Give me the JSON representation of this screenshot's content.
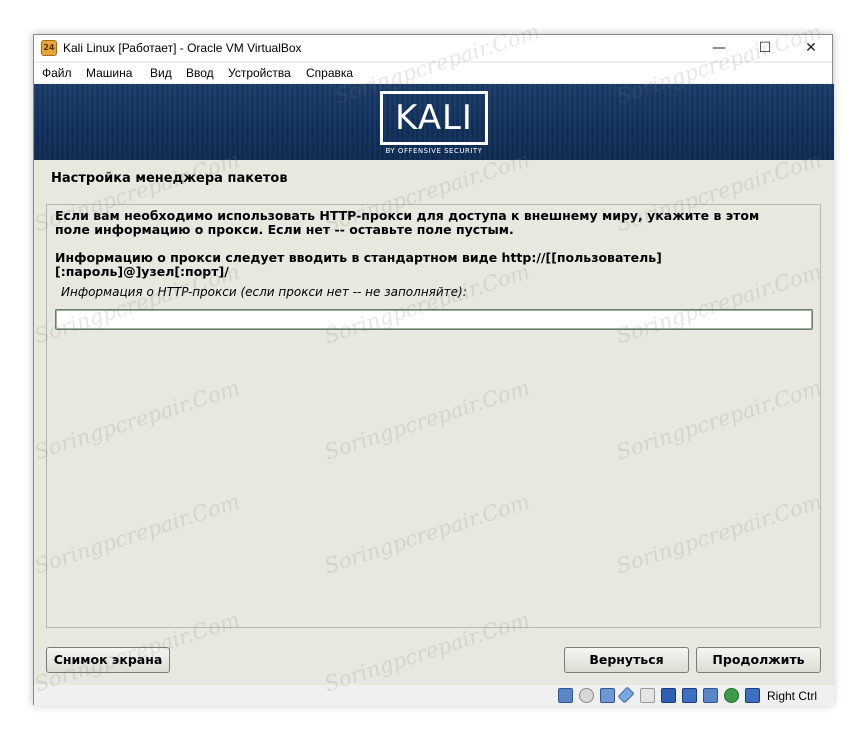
{
  "window": {
    "title": "Kali Linux [Работает] - Oracle VM VirtualBox",
    "icon_label": "24",
    "controls": {
      "minimize": "—",
      "maximize": "☐",
      "close": "✕"
    }
  },
  "menu": [
    "Файл",
    "Машина",
    "Вид",
    "Ввод",
    "Устройства",
    "Справка"
  ],
  "banner": {
    "logo": "KALI",
    "tagline": "BY OFFENSIVE SECURITY"
  },
  "installer": {
    "section_title": "Настройка менеджера пакетов",
    "description_1": "Если вам необходимо использовать HTTP-прокси для доступа к внешнему миру, укажите в этом поле информацию о прокси. Если нет -- оставьте поле пустым.",
    "description_2": "Информацию о прокси следует вводить в стандартном виде http://[[пользователь][:пароль]@]узел[:порт]/",
    "field_label": "Информация о HTTP-прокси (если прокси нет -- не заполняйте):",
    "field_value": ""
  },
  "buttons": {
    "screenshot": "Снимок экрана",
    "back": "Вернуться",
    "continue": "Продолжить"
  },
  "statusbar": {
    "icons": [
      "hdd-icon",
      "optical-drive-icon",
      "network-icon",
      "usb-icon",
      "shared-folders-icon",
      "display-icon",
      "recording-icon",
      "cpu-icon",
      "mouse-integration-icon",
      "keyboard-icon"
    ],
    "host_key": "Right Ctrl"
  },
  "watermark": "Soringpcrepair.Com"
}
